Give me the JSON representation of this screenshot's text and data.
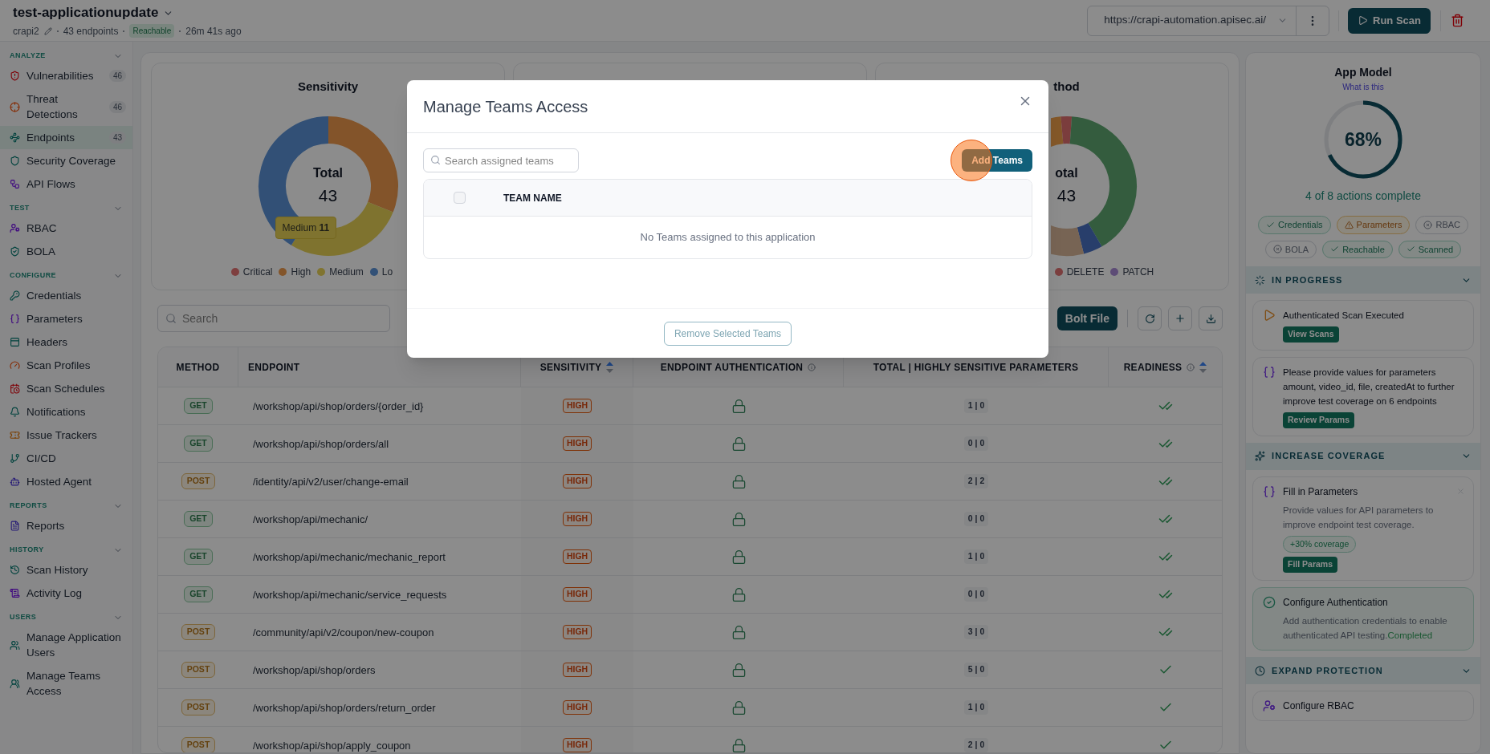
{
  "header": {
    "title": "test-applicationupdate",
    "owner": "crapi2",
    "endpoints": "43 endpoints",
    "status": "Reachable",
    "time": "26m 41s ago",
    "url": "https://crapi-automation.apisec.ai/",
    "run_button": "Run Scan"
  },
  "sidebar": {
    "sections": [
      {
        "title": "ANALYZE",
        "expanded": true,
        "items": [
          {
            "label": "Vulnerabilities",
            "count": "46",
            "selected": false
          },
          {
            "label": "Threat Detections",
            "count": "46",
            "selected": false
          },
          {
            "label": "Endpoints",
            "count": "43",
            "selected": true
          },
          {
            "label": "Security Coverage",
            "selected": false
          },
          {
            "label": "API Flows",
            "selected": false
          }
        ]
      },
      {
        "title": "TEST",
        "expanded": true,
        "items": [
          {
            "label": "RBAC",
            "selected": false
          },
          {
            "label": "BOLA",
            "selected": false
          }
        ]
      },
      {
        "title": "CONFIGURE",
        "expanded": true,
        "items": [
          {
            "label": "Credentials",
            "selected": false
          },
          {
            "label": "Parameters",
            "selected": false
          },
          {
            "label": "Headers",
            "selected": false
          },
          {
            "label": "Scan Profiles",
            "selected": false
          },
          {
            "label": "Scan Schedules",
            "selected": false
          },
          {
            "label": "Notifications",
            "selected": false
          },
          {
            "label": "Issue Trackers",
            "selected": false
          },
          {
            "label": "CI/CD",
            "selected": false
          },
          {
            "label": "Hosted Agent",
            "selected": false
          }
        ]
      },
      {
        "title": "REPORTS",
        "expanded": true,
        "items": [
          {
            "label": "Reports",
            "selected": false
          }
        ]
      },
      {
        "title": "HISTORY",
        "expanded": true,
        "items": [
          {
            "label": "Scan History",
            "selected": false
          },
          {
            "label": "Activity Log",
            "selected": false
          }
        ]
      },
      {
        "title": "USERS",
        "expanded": true,
        "items": [
          {
            "label": "Manage Application Users",
            "selected": false
          },
          {
            "label": "Manage Teams Access",
            "selected": false
          }
        ]
      }
    ]
  },
  "charts": [
    {
      "title": "Sensitivity",
      "center_label": "Total",
      "center_value": "43",
      "tooltip": {
        "label": "Medium",
        "value": "11"
      },
      "legend": [
        {
          "label": "Critical",
          "color": "#7e3f3f"
        },
        {
          "label": "High",
          "color": "#83552a"
        },
        {
          "label": "Medium",
          "color": "#807430"
        },
        {
          "label": "Lo",
          "color": "#325177"
        }
      ]
    },
    {
      "title": "thod",
      "center_label": "otal",
      "center_value": "43",
      "legend": [
        {
          "label": "DELETE",
          "color": "#7b3e3e"
        },
        {
          "label": "PATCH",
          "color": "#5d4c76"
        }
      ]
    }
  ],
  "toolbar": {
    "search_placeholder": "Search",
    "upload_button": "Bolt File"
  },
  "table": {
    "columns": [
      {
        "label": "METHOD",
        "sortable": false,
        "info": false
      },
      {
        "label": "ENDPOINT",
        "sortable": false,
        "info": false
      },
      {
        "label": "SENSITIVITY",
        "sortable": true,
        "info": false
      },
      {
        "label": "ENDPOINT AUTHENTICATION",
        "sortable": false,
        "info": true
      },
      {
        "label": "TOTAL | HIGHLY SENSITIVE PARAMETERS",
        "sortable": false,
        "info": false
      },
      {
        "label": "READINESS",
        "sortable": true,
        "info": true
      }
    ],
    "rows": [
      {
        "method": "GET",
        "kind": "get",
        "endpoint": "/workshop/api/shop/orders/{order_id}",
        "sensitivity": "HIGH",
        "params": "1 | 0",
        "fully_ready": true
      },
      {
        "method": "GET",
        "kind": "get",
        "endpoint": "/workshop/api/shop/orders/all",
        "sensitivity": "HIGH",
        "params": "0 | 0",
        "fully_ready": true
      },
      {
        "method": "POST",
        "kind": "post",
        "endpoint": "/identity/api/v2/user/change-email",
        "sensitivity": "HIGH",
        "params": "2 | 2",
        "fully_ready": true
      },
      {
        "method": "GET",
        "kind": "get",
        "endpoint": "/workshop/api/mechanic/",
        "sensitivity": "HIGH",
        "params": "0 | 0",
        "fully_ready": true
      },
      {
        "method": "GET",
        "kind": "get",
        "endpoint": "/workshop/api/mechanic/mechanic_report",
        "sensitivity": "HIGH",
        "params": "1 | 0",
        "fully_ready": true
      },
      {
        "method": "GET",
        "kind": "get",
        "endpoint": "/workshop/api/mechanic/service_requests",
        "sensitivity": "HIGH",
        "params": "0 | 0",
        "fully_ready": true
      },
      {
        "method": "POST",
        "kind": "post",
        "endpoint": "/community/api/v2/coupon/new-coupon",
        "sensitivity": "HIGH",
        "params": "3 | 0",
        "fully_ready": true
      },
      {
        "method": "POST",
        "kind": "post",
        "endpoint": "/workshop/api/shop/orders",
        "sensitivity": "HIGH",
        "params": "5 | 0",
        "fully_ready": false
      },
      {
        "method": "POST",
        "kind": "post",
        "endpoint": "/workshop/api/shop/orders/return_order",
        "sensitivity": "HIGH",
        "params": "1 | 0",
        "fully_ready": false
      },
      {
        "method": "POST",
        "kind": "post",
        "endpoint": "/workshop/api/shop/apply_coupon",
        "sensitivity": "HIGH",
        "params": "2 | 0",
        "fully_ready": false
      }
    ]
  },
  "app_model": {
    "title": "App Model",
    "link": "What is this",
    "level": 0.68,
    "percent": "68%",
    "summary": "4 of 8 actions complete",
    "chips": [
      {
        "label": "Credentials",
        "kind": "done"
      },
      {
        "label": "Parameters",
        "kind": "warning"
      },
      {
        "label": "RBAC",
        "kind": "missing"
      },
      {
        "label": "BOLA",
        "kind": "missing"
      },
      {
        "label": "Reachable",
        "kind": "done"
      },
      {
        "label": "Scanned",
        "kind": "done"
      }
    ]
  },
  "panel_sections": [
    {
      "title": "IN PROGRESS",
      "expanded": true,
      "cards": [
        {
          "kind": "scan",
          "text": "Authenticated Scan Executed",
          "button": "View Scans"
        },
        {
          "kind": "params",
          "text": "Please provide values for parameters amount, video_id, file, createdAt to further improve test coverage on 6 endpoints",
          "button": "Review Params"
        }
      ]
    },
    {
      "title": "INCREASE COVERAGE",
      "expanded": true,
      "cards": [
        {
          "kind": "params",
          "title": "Fill in Parameters",
          "text": "Provide values for API parameters to improve endpoint test coverage.",
          "badge": "+30% coverage",
          "button": "Fill Params",
          "dismissible": true
        },
        {
          "kind": "completed",
          "title": "Configure Authentication",
          "text": "Add authentication credentials to enable authenticated API testing.",
          "status": "Completed"
        }
      ]
    },
    {
      "title": "EXPAND PROTECTION",
      "expanded": true,
      "cards": [
        {
          "kind": "rbac",
          "title": "Configure RBAC"
        }
      ]
    }
  ],
  "modal": {
    "title": "Manage Teams Access",
    "search_placeholder": "Search assigned teams",
    "add_button": "Add Teams",
    "select_all_checked": false,
    "column": "TEAM NAME",
    "empty_text": "No Teams assigned to this application",
    "remove_button": "Remove Selected Teams",
    "remove_disabled": true,
    "click_highlight": true
  }
}
